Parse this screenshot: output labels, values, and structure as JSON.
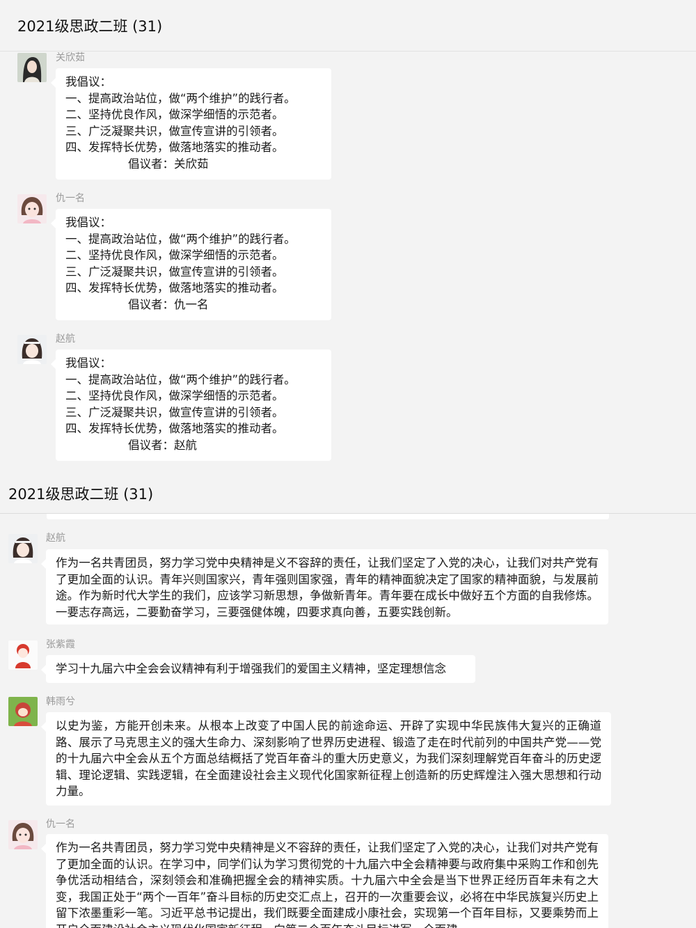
{
  "window1": {
    "title": "2021级思政二班 (31)"
  },
  "window2": {
    "title": "2021级思政二班 (31)"
  },
  "proposal": {
    "heading": "我倡议：",
    "items": [
      "一、提高政治站位，做“两个维护”的践行者。",
      "二、坚持优良作风，做深学细悟的示范者。",
      "三、广泛凝聚共识，做宣传宣讲的引领者。",
      "四、发挥特长优势，做落地落实的推动者。"
    ]
  },
  "messages1": [
    {
      "sender": "关欣茹",
      "signer": "倡议者：关欣茹",
      "avatar": "avatar-woman-dark-hair"
    },
    {
      "sender": "仇一名",
      "signer": "倡议者：仇一名",
      "avatar": "avatar-girl-pink"
    },
    {
      "sender": "赵航",
      "signer": "倡议者：赵航",
      "avatar": "avatar-girl-headband"
    }
  ],
  "messages2": [
    {
      "sender": "赵航",
      "avatar": "avatar-girl-headband",
      "text": "作为一名共青团员，努力学习党中央精神是义不容辞的责任，让我们坚定了入党的决心，让我们对共产党有了更加全面的认识。青年兴则国家兴，青年强则国家强，青年的精神面貌决定了国家的精神面貌，与发展前途。作为新时代大学生的我们，应该学习新思想，争做新青年。青年要在成长中做好五个方面的自我修炼。一要志存高远，二要勤奋学习，三要强健体魄，四要求真向善，五要实践创新。"
    },
    {
      "sender": "张紫霞",
      "avatar": "avatar-cartoon-red",
      "text": "学习十九届六中全会会议精神有利于增强我们的爱国主义精神，坚定理想信念"
    },
    {
      "sender": "韩雨兮",
      "avatar": "avatar-cartoon-green",
      "text": "以史为鉴，方能开创未来。从根本上改变了中国人民的前途命运、开辟了实现中华民族伟大复兴的正确道路、展示了马克思主义的强大生命力、深刻影响了世界历史进程、锻造了走在时代前列的中国共产党——党的十九届六中全会从五个方面总结概括了党百年奋斗的重大历史意义，为我们深刻理解党百年奋斗的历史逻辑、理论逻辑、实践逻辑，在全面建设社会主义现代化国家新征程上创造新的历史辉煌注入强大思想和行动力量。"
    },
    {
      "sender": "仇一名",
      "avatar": "avatar-girl-pink",
      "text": "作为一名共青团员，努力学习党中央精神是义不容辞的责任，让我们坚定了入党的决心，让我们对共产党有了更加全面的认识。在学习中，同学们认为学习贯彻党的十九届六中全会精神要与政府集中采购工作和创先争优活动相结合，深刻领会和准确把握全会的精神实质。十九届六中全会是当下世界正经历百年未有之大变，我国正处于“两个一百年”奋斗目标的历史交汇点上，召开的一次重要会议，必将在中华民族复兴历史上留下浓墨重彩一笔。习近平总书记提出，我们既要全面建成小康社会，实现第一个百年目标，又要乘势而上开启全面建设社会主义现代化国家新征程，向第二个百年奋斗目标进军。全面建"
    }
  ]
}
